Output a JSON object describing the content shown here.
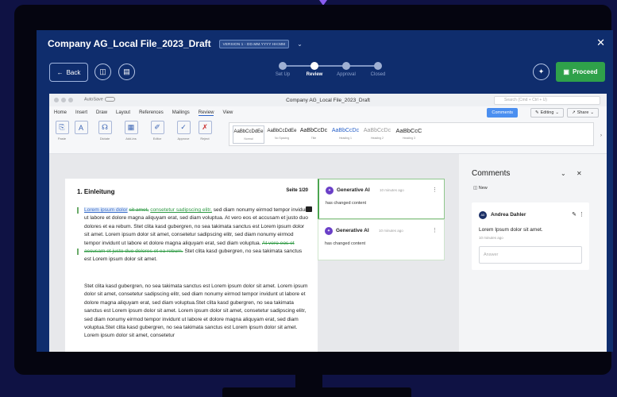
{
  "app": {
    "title": "Company AG_Local File_2023_Draft",
    "version_chip": "VERSION 1 - DD.MM.YYYY HH:MM",
    "dropdown_icon": "chevron-down-icon",
    "close_icon": "close-icon"
  },
  "actions": {
    "back_label": "Back",
    "proceed_label": "Proceed",
    "icons": [
      "arrow-left-icon",
      "clipboard-icon",
      "document-icon",
      "sparkle-icon",
      "save-icon"
    ]
  },
  "steps": [
    {
      "label": "Set Up",
      "active": false
    },
    {
      "label": "Review",
      "active": true
    },
    {
      "label": "Approval",
      "active": false
    },
    {
      "label": "Closed",
      "active": false
    }
  ],
  "word": {
    "autosave_label": "AutoSave",
    "doc_title": "Company AG_Local File_2023_Draft",
    "search_placeholder": "Search (Cmd + Ctrl + U)",
    "menu": [
      "Home",
      "Insert",
      "Draw",
      "Layout",
      "References",
      "Mailings",
      "Review",
      "View"
    ],
    "selected_menu": "Review",
    "comments_label": "Comments",
    "editing_label": "Editing",
    "share_label": "Share",
    "ribbon_buttons": [
      {
        "label": "Paste",
        "icon": "paste-icon"
      },
      {
        "label": "Dictate",
        "icon": "microphone-icon"
      },
      {
        "label": "Add-ins",
        "icon": "grid-icon"
      },
      {
        "label": "Editor",
        "icon": "pen-icon"
      },
      {
        "label": "Approve",
        "icon": "check-icon"
      },
      {
        "label": "Reject",
        "icon": "x-icon"
      }
    ],
    "styles": [
      {
        "sample": "AaBbCcDdEe",
        "name": "Normal"
      },
      {
        "sample": "AaBbCcDdEe",
        "name": "No Spacing"
      },
      {
        "sample": "AaBbCcDc",
        "name": "Title"
      },
      {
        "sample": "AaBbCcDc",
        "name": "Heading 1"
      },
      {
        "sample": "AaBbCcDc",
        "name": "Heading 2"
      },
      {
        "sample": "AaBbCcC",
        "name": "Heading 3"
      }
    ]
  },
  "document": {
    "heading": "1. Einleitung",
    "page_number": "Seite 1/20",
    "p1_hl": "Lorem ipsum dolor",
    "p1_strike": "sit amet,",
    "p1_ins": "consetetur sadipscing elitr,",
    "p1_rest": " sed diam nonumy eirmod tempor invidunt ut labore et dolore magna aliquyam erat, sed diam voluptua. At vero eos et accusam et justo duo dolores et ea rebum. Stet clita kasd gubergren, no sea takimata sanctus est Lorem ipsum dolor sit amet. Lorem ipsum dolor sit amet, consetetur sadipscing elitr, sed diam nonumy eirmod tempor invidunt ut labore et dolore magna aliquyam erat, sed diam voluptua.",
    "p1_strike2": "At vero eos et accusam et justo duo dolores et ea rebum.",
    "p1_tail": " Stet clita kasd gubergren, no sea takimata sanctus est Lorem ipsum dolor sit amet.",
    "p2": "Stet clita kasd gubergren, no sea takimata sanctus est Lorem ipsum dolor sit amet. Lorem ipsum dolor sit amet, consetetur sadipscing elitr, sed diam nonumy eirmod tempor invidunt ut labore et dolore magna aliquyam erat, sed diam voluptua.Stet clita kasd gubergren, no sea takimata sanctus est Lorem ipsum dolor sit amet. Lorem ipsum dolor sit amet, consetetur sadipscing elitr, sed diam nonumy eirmod tempor invidunt ut labore et dolore magna aliquyam erat, sed diam voluptua.Stet clita kasd gubergren, no sea takimata sanctus est Lorem ipsum dolor sit amet. Lorem ipsum dolor sit amet, consetetur"
  },
  "ai_comments": [
    {
      "author": "Generative AI",
      "time": "10 minutes ago",
      "text": "has changed content"
    },
    {
      "author": "Generative AI",
      "time": "10 minutes ago",
      "text": "has changed content"
    }
  ],
  "comments_panel": {
    "title": "Comments",
    "new_label": "New",
    "author_initials": "AD",
    "author": "Andrea Dahler",
    "text": "Lorem Ipsum dolor sit amet.",
    "time": "10 minutes ago",
    "answer_placeholder": "Answer"
  },
  "colors": {
    "background": "#0f1244",
    "screen": "#0f2d6d",
    "proceed": "#2fa14a",
    "ai_avatar": "#6a3fc7",
    "insert_green": "#2f9a44",
    "accent_blue": "#4b8ff0"
  }
}
